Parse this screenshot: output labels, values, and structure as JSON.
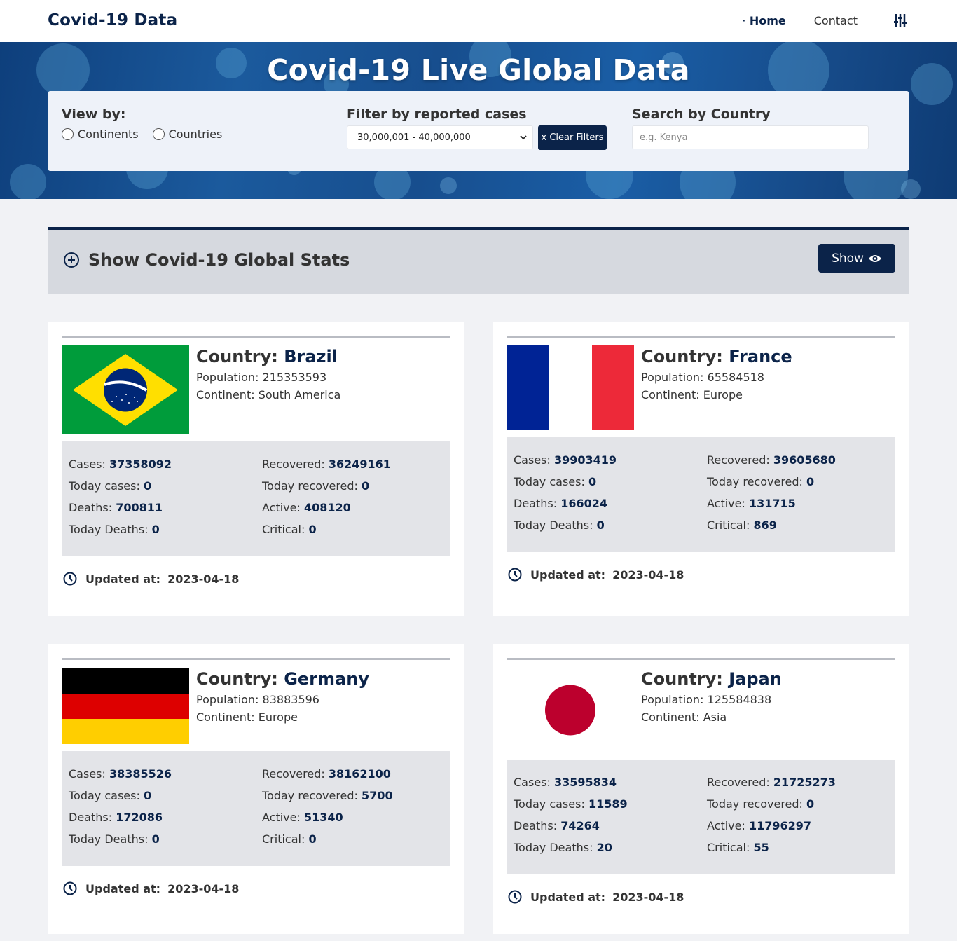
{
  "nav": {
    "brand": "Covid-19 Data",
    "home": "Home",
    "contact": "Contact"
  },
  "hero": {
    "title": "Covid-19 Live Global Data",
    "view_by_label": "View by:",
    "view_options": [
      "Continents",
      "Countries"
    ],
    "filter_label": "Filter by reported cases",
    "filter_selected": "30,000,001 - 40,000,000",
    "clear_button": "x Clear Filters",
    "search_label": "Search by Country",
    "search_placeholder": "e.g. Kenya"
  },
  "global_stats": {
    "title": "Show Covid-19 Global Stats",
    "button": "Show"
  },
  "labels": {
    "country": "Country:",
    "population": "Population:",
    "continent": "Continent:",
    "cases": "Cases:",
    "today_cases": "Today cases:",
    "deaths": "Deaths:",
    "today_deaths": "Today Deaths:",
    "recovered": "Recovered:",
    "today_recovered": "Today recovered:",
    "active": "Active:",
    "critical": "Critical:",
    "updated_at": "Updated at:"
  },
  "countries": [
    {
      "name": "Brazil",
      "population": "215353593",
      "continent": "South America",
      "cases": "37358092",
      "today_cases": "0",
      "deaths": "700811",
      "today_deaths": "0",
      "recovered": "36249161",
      "today_recovered": "0",
      "active": "408120",
      "critical": "0",
      "updated": "2023-04-18",
      "flag": "brazil-flag"
    },
    {
      "name": "France",
      "population": "65584518",
      "continent": "Europe",
      "cases": "39903419",
      "today_cases": "0",
      "deaths": "166024",
      "today_deaths": "0",
      "recovered": "39605680",
      "today_recovered": "0",
      "active": "131715",
      "critical": "869",
      "updated": "2023-04-18",
      "flag": "france-flag"
    },
    {
      "name": "Germany",
      "population": "83883596",
      "continent": "Europe",
      "cases": "38385526",
      "today_cases": "0",
      "deaths": "172086",
      "today_deaths": "0",
      "recovered": "38162100",
      "today_recovered": "5700",
      "active": "51340",
      "critical": "0",
      "updated": "2023-04-18",
      "flag": "germany-flag"
    },
    {
      "name": "Japan",
      "population": "125584838",
      "continent": "Asia",
      "cases": "33595834",
      "today_cases": "11589",
      "deaths": "74264",
      "today_deaths": "20",
      "recovered": "21725273",
      "today_recovered": "0",
      "active": "11796297",
      "critical": "55",
      "updated": "2023-04-18",
      "flag": "japan-flag"
    }
  ],
  "colors": {
    "navy": "#0b2349",
    "brazil_green": "#009c3b",
    "brazil_yellow": "#ffdf00",
    "brazil_blue": "#002776",
    "france_blue": "#002395",
    "france_red": "#ed2939",
    "germany_red": "#dd0000",
    "germany_gold": "#ffce00",
    "japan_red": "#bc002d"
  }
}
